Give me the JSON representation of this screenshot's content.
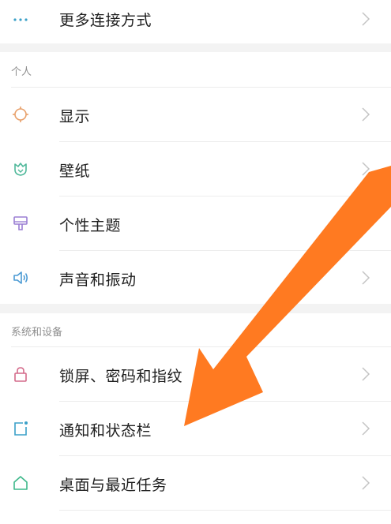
{
  "more_connections": {
    "label": "更多连接方式",
    "icon": "more-dots-icon"
  },
  "sections": [
    {
      "title": "个人",
      "items": [
        {
          "label": "显示",
          "icon": "sun-icon",
          "color": "#e8a06a"
        },
        {
          "label": "壁纸",
          "icon": "tulip-icon",
          "color": "#4fb89a"
        },
        {
          "label": "个性主题",
          "icon": "brush-icon",
          "color": "#9b7fd4"
        },
        {
          "label": "声音和振动",
          "icon": "speaker-icon",
          "color": "#4a9ad4"
        }
      ]
    },
    {
      "title": "系统和设备",
      "items": [
        {
          "label": "锁屏、密码和指纹",
          "icon": "lock-icon",
          "color": "#d46a8a"
        },
        {
          "label": "通知和状态栏",
          "icon": "notification-icon",
          "color": "#3aa0c8"
        },
        {
          "label": "桌面与最近任务",
          "icon": "home-icon",
          "color": "#3db88a"
        }
      ]
    }
  ],
  "overlay": {
    "arrow_color": "#ff7a21",
    "arrow_icon": "pointer-arrow-icon"
  }
}
